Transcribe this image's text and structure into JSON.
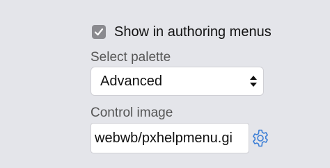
{
  "authoring": {
    "checked": true,
    "label": "Show in authoring menus"
  },
  "palette": {
    "label": "Select palette",
    "selected": "Advanced"
  },
  "control_image": {
    "label": "Control image",
    "value": "webwb/pxhelpmenu.gi"
  },
  "icons": {
    "checkbox_mark": "checkmark-icon",
    "select_arrows": "select-arrows-icon",
    "settings": "gear-icon"
  },
  "colors": {
    "background": "#e4e5ea",
    "checkbox_fill": "#8a8a8f",
    "gear_accent": "#3d7fd6",
    "label_text": "#555555"
  }
}
